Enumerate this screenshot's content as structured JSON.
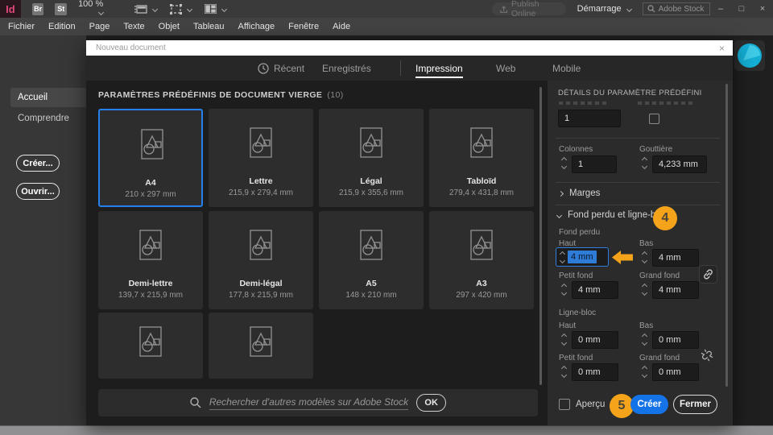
{
  "topbar": {
    "logo": "Id",
    "badge_br": "Br",
    "badge_st": "St",
    "zoom_value": "100 %",
    "publish_online": "Publish Online",
    "workspace": "Démarrage",
    "stock_placeholder": "Adobe Stock",
    "window_minimize": "–",
    "window_maximize": "□",
    "window_close": "×"
  },
  "menubar": {
    "items": [
      "Fichier",
      "Edition",
      "Page",
      "Texte",
      "Objet",
      "Tableau",
      "Affichage",
      "Fenêtre",
      "Aide"
    ]
  },
  "sidebar": {
    "home": "Accueil",
    "learn": "Comprendre",
    "create_button": "Créer...",
    "open_button": "Ouvrir..."
  },
  "dialog": {
    "title": "Nouveau document",
    "close_x": "×",
    "tabs": {
      "recent": "Récent",
      "saved": "Enregistrés",
      "print": "Impression",
      "web": "Web",
      "mobile": "Mobile"
    },
    "presets_header": "PARAMÈTRES PRÉDÉFINIS DE DOCUMENT VIERGE",
    "presets_count": "(10)",
    "presets": [
      {
        "name": "A4",
        "size": "210 x 297 mm"
      },
      {
        "name": "Lettre",
        "size": "215,9 x 279,4 mm"
      },
      {
        "name": "Légal",
        "size": "215,9 x 355,6 mm"
      },
      {
        "name": "Tabloïd",
        "size": "279,4 x 431,8 mm"
      },
      {
        "name": "Demi-lettre",
        "size": "139,7 x 215,9 mm"
      },
      {
        "name": "Demi-légal",
        "size": "177,8 x 215,9 mm"
      },
      {
        "name": "A5",
        "size": "148 x 210 mm"
      },
      {
        "name": "A3",
        "size": "297 x 420 mm"
      },
      {
        "name": "",
        "size": ""
      },
      {
        "name": "",
        "size": ""
      }
    ],
    "stock_bar": {
      "placeholder": "Rechercher d'autres modèles sur Adobe Stock",
      "ok": "OK"
    }
  },
  "panel": {
    "header": "DÉTAILS DU PARAMÈTRE PRÉDÉFINI",
    "pages_value": "1",
    "columns_label": "Colonnes",
    "columns_value": "1",
    "gutter_label": "Gouttière",
    "gutter_value": "4,233 mm",
    "margins_label": "Marges",
    "bleed_slug_label": "Fond perdu et ligne-bloc",
    "bleed_label": "Fond perdu",
    "slug_label": "Ligne-bloc",
    "top_label": "Haut",
    "bottom_label": "Bas",
    "inside_label": "Petit fond",
    "outside_label": "Grand fond",
    "bleed_top": "4 mm",
    "bleed_bottom": "4 mm",
    "bleed_inside": "4 mm",
    "bleed_outside": "4 mm",
    "slug_top": "0 mm",
    "slug_bottom": "0 mm",
    "slug_inside": "0 mm",
    "slug_outside": "0 mm",
    "preview_label": "Aperçu",
    "create_button": "Créer",
    "close_button": "Fermer"
  },
  "annotations": {
    "step4": "4",
    "step5": "5"
  },
  "colors": {
    "accent_blue": "#1473e6",
    "selection_blue": "#2680eb",
    "annotation_orange": "#f5a31b",
    "cc_cyan": "#1fb9dd"
  }
}
